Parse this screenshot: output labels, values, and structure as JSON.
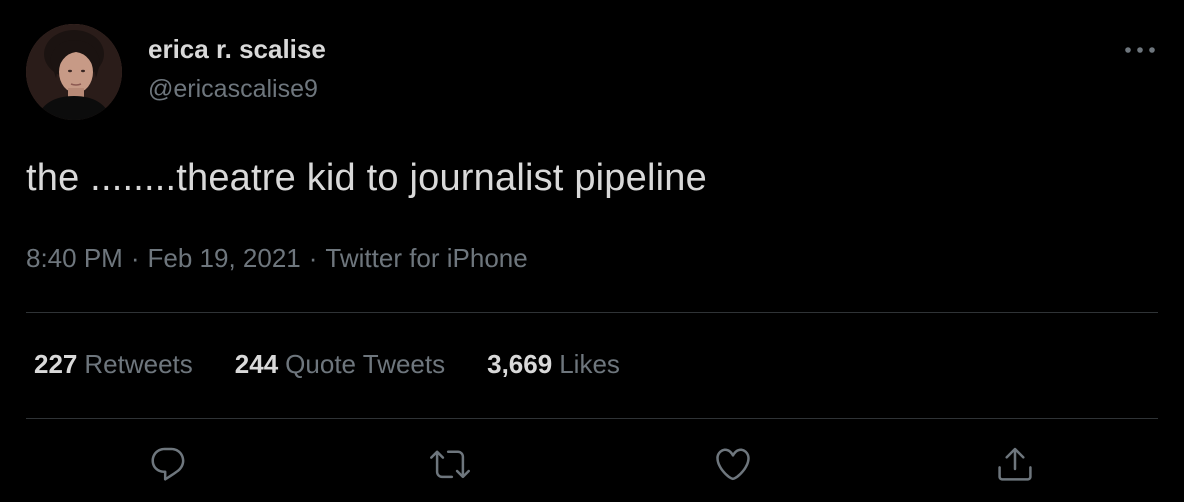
{
  "author": {
    "display_name": "erica r. scalise",
    "handle": "@ericascalise9",
    "avatar": "profile-photo"
  },
  "tweet": {
    "text": "the ........theatre kid to journalist pipeline",
    "time": "8:40 PM",
    "separator": "·",
    "date": "Feb 19, 2021",
    "source": "Twitter for iPhone"
  },
  "stats": {
    "retweets_count": "227",
    "retweets_label": "Retweets",
    "quotes_count": "244",
    "quotes_label": "Quote Tweets",
    "likes_count": "3,669",
    "likes_label": "Likes"
  },
  "icons": {
    "more": "more-options-icon",
    "reply": "reply-icon",
    "retweet": "retweet-icon",
    "like": "heart-icon",
    "share": "share-icon"
  },
  "colors": {
    "background": "#000000",
    "primary_text": "#d9d9d9",
    "secondary_text": "#6e767d",
    "divider": "#2f3336"
  }
}
